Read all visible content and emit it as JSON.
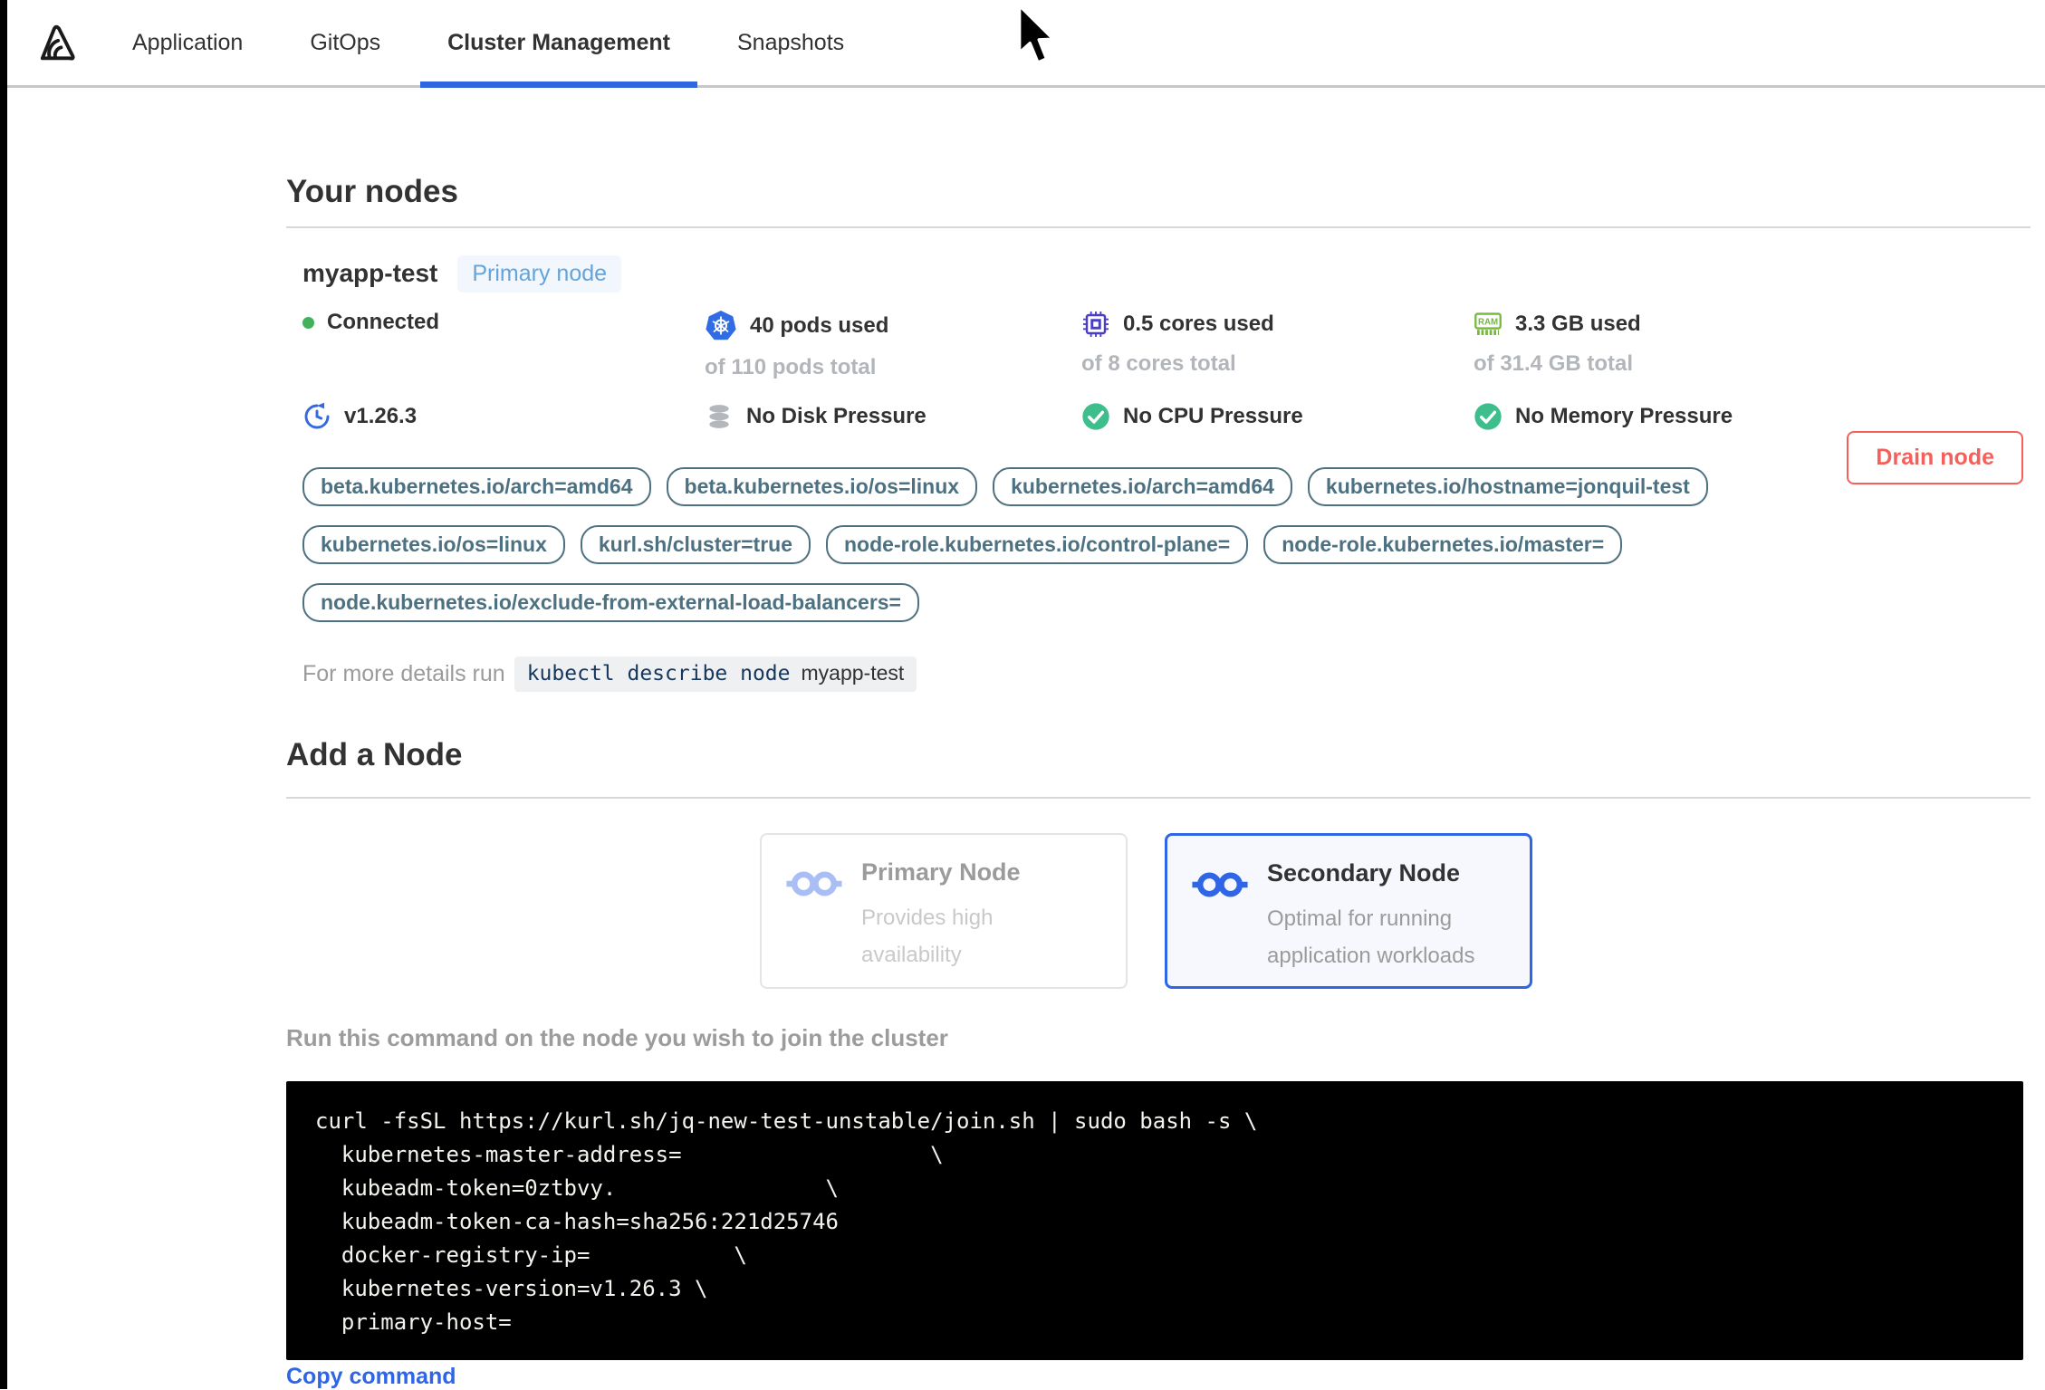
{
  "nav": {
    "tabs": [
      {
        "label": "Application"
      },
      {
        "label": "GitOps"
      },
      {
        "label": "Cluster Management"
      },
      {
        "label": "Snapshots"
      }
    ]
  },
  "your_nodes": {
    "title": "Your nodes",
    "node": {
      "name": "myapp-test",
      "badge": "Primary node",
      "status": "Connected",
      "version": "v1.26.3",
      "stats": [
        {
          "used": "40 pods used",
          "total": "of 110 pods total"
        },
        {
          "used": "0.5 cores used",
          "total": "of 8 cores total"
        },
        {
          "used": "3.3 GB used",
          "total": "of 31.4 GB total"
        }
      ],
      "conditions": [
        {
          "label": "No Disk Pressure"
        },
        {
          "label": "No CPU Pressure"
        },
        {
          "label": "No Memory Pressure"
        }
      ],
      "label_rows": [
        [
          "beta.kubernetes.io/arch=amd64",
          "beta.kubernetes.io/os=linux",
          "kubernetes.io/arch=amd64",
          "kubernetes.io/hostname=jonquil-test"
        ],
        [
          "kubernetes.io/os=linux",
          "kurl.sh/cluster=true",
          "node-role.kubernetes.io/control-plane=",
          "node-role.kubernetes.io/master="
        ],
        [
          "node.kubernetes.io/exclude-from-external-load-balancers="
        ]
      ],
      "details_prefix": "For more details run",
      "details_command": "kubectl describe node",
      "details_node": "myapp-test",
      "drain_button": "Drain node"
    }
  },
  "add_node": {
    "title": "Add a Node",
    "options": [
      {
        "title": "Primary Node",
        "description": "Provides high availability",
        "state": "disabled"
      },
      {
        "title": "Secondary Node",
        "description": "Optimal for running application workloads",
        "state": "selected"
      }
    ],
    "instruction": "Run this command on the node you wish to join the cluster",
    "command_lines": [
      "curl -fsSL https://kurl.sh/jq-new-test-unstable/join.sh | sudo bash -s \\",
      "  kubernetes-master-address=                   \\",
      "  kubeadm-token=0ztbvy.                \\",
      "  kubeadm-token-ca-hash=sha256:221d25746",
      "  docker-registry-ip=           \\",
      "  kubernetes-version=v1.26.3 \\",
      "  primary-host="
    ],
    "copy_label": "Copy command"
  },
  "colors": {
    "accent_blue": "#3066e0",
    "selected_blue": "#2f66e5",
    "badge_blue": "#65a3d9",
    "connected_green": "#42b15b",
    "check_green": "#3dbe8c",
    "ram_green": "#76b83a",
    "kubernetes_blue": "#326ce5",
    "cpu_indigo": "#4a3ec8",
    "label_teal": "#4d7180",
    "danger_red": "#f5605a"
  }
}
